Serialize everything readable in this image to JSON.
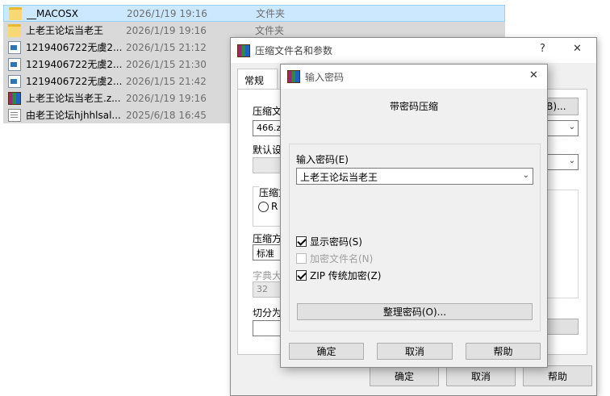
{
  "files": [
    {
      "name": "__MACOSX",
      "date": "2026/1/19 19:16",
      "type": "文件夹",
      "icon": "folder-icon"
    },
    {
      "name": "上老王论坛当老王",
      "date": "2026/1/19 19:16",
      "type": "文件夹",
      "icon": "folder-icon"
    },
    {
      "name": "1219406722无虞2...",
      "date": "2026/1/15 21:12",
      "type": "",
      "icon": "doc-icon"
    },
    {
      "name": "1219406722无虞2...",
      "date": "2026/1/15 21:30",
      "type": "",
      "icon": "doc-icon"
    },
    {
      "name": "1219406722无虞2...",
      "date": "2026/1/15 21:42",
      "type": "",
      "icon": "doc-icon"
    },
    {
      "name": "上老王论坛当老王.z...",
      "date": "2026/1/19 19:16",
      "type": "",
      "icon": "rar-icon"
    },
    {
      "name": "由老王论坛hjhhlsal...",
      "date": "2025/6/18 16:45",
      "type": "",
      "icon": "txt-icon"
    }
  ],
  "back_dialog": {
    "title": "压缩文件名和参数",
    "help_glyph": "?",
    "close_glyph": "✕",
    "tab_label": "常规",
    "archive_name_label": "压缩文",
    "archive_name_value": "466.zip",
    "browse_label": "(B)...",
    "default_label": "默认设",
    "format_label": "压缩文",
    "format_option": "R",
    "method_label": "压缩方",
    "method_value": "标准",
    "dict_label": "字典大",
    "dict_value": "32",
    "split_label": "切分为",
    "ok_label": "确定",
    "cancel_label": "取消",
    "help_label": "帮助"
  },
  "front_dialog": {
    "title": "输入密码",
    "close_glyph": "✕",
    "heading": "带密码压缩",
    "password_label": "输入密码(E)",
    "password_value": "上老王论坛当老王",
    "show_password_label": "显示密码(S)",
    "show_password_checked": true,
    "encrypt_names_label": "加密文件名(N)",
    "encrypt_names_checked": false,
    "zip_legacy_label": "ZIP 传统加密(Z)",
    "zip_legacy_checked": true,
    "organize_label": "整理密码(O)...",
    "ok_label": "确定",
    "cancel_label": "取消",
    "help_label": "帮助"
  },
  "colors": {
    "selection": "#cce8ff",
    "dialog_bg": "#f0f0f0"
  }
}
